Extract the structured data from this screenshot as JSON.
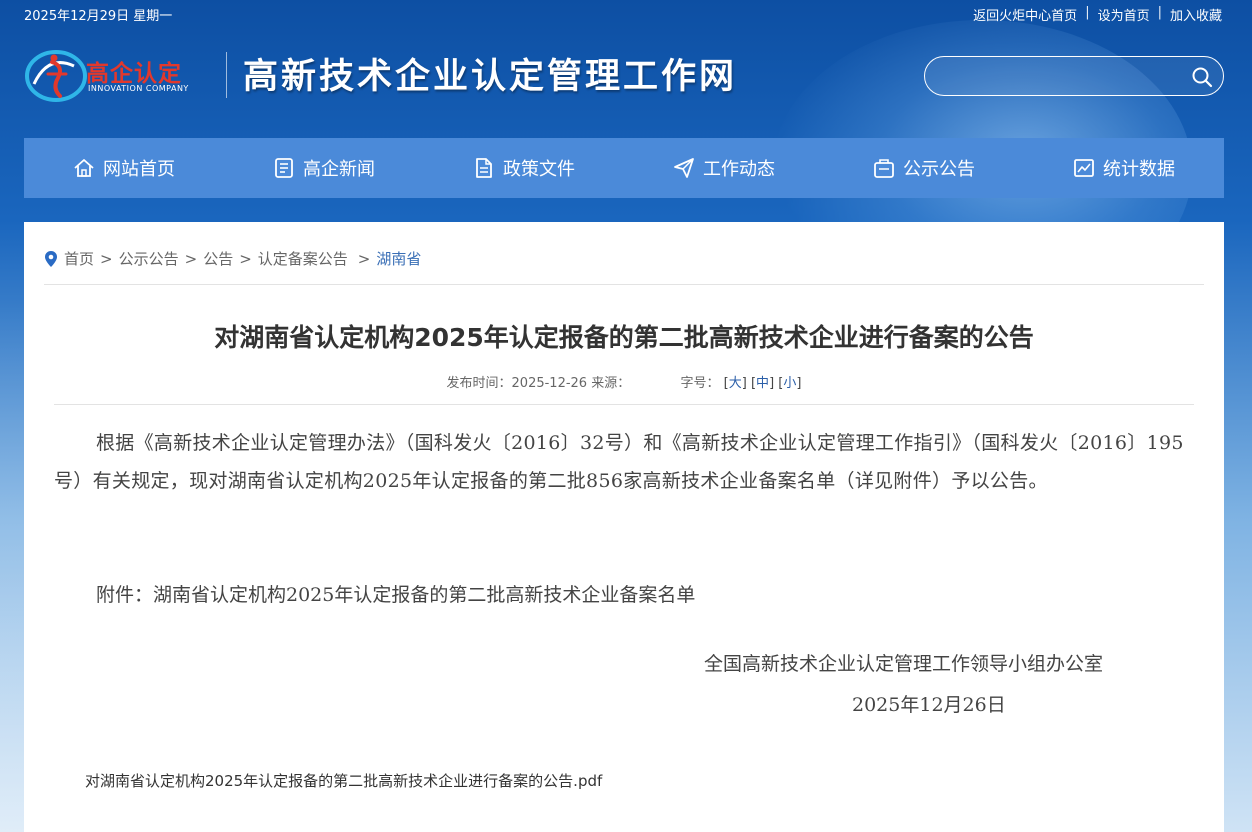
{
  "topbar": {
    "date": "2025年12月29日 星期一",
    "links": [
      "返回火炬中心首页",
      "设为首页",
      "加入收藏"
    ]
  },
  "logo": {
    "cn": "高企认定",
    "en": "INNOVATION COMPANY"
  },
  "site_title": "高新技术企业认定管理工作网",
  "search": {
    "placeholder": "",
    "icon": "search-icon"
  },
  "nav": [
    {
      "label": "网站首页",
      "icon": "home-icon"
    },
    {
      "label": "高企新闻",
      "icon": "news-icon"
    },
    {
      "label": "政策文件",
      "icon": "document-icon"
    },
    {
      "label": "工作动态",
      "icon": "paper-plane-icon"
    },
    {
      "label": "公示公告",
      "icon": "announcement-icon"
    },
    {
      "label": "统计数据",
      "icon": "chart-icon"
    }
  ],
  "breadcrumb": {
    "items": [
      "首页",
      "公示公告",
      "公告",
      "认定备案公告"
    ],
    "separator": ">",
    "current": "湖南省"
  },
  "article": {
    "title": "对湖南省认定机构2025年认定报备的第二批高新技术企业进行备案的公告",
    "meta_time": "发布时间：2025-12-26 来源：",
    "font_size_label": "字号：",
    "font_sizes": [
      "大",
      "中",
      "小"
    ],
    "paragraph1": "根据《高新技术企业认定管理办法》（国科发火〔2016〕32号）和《高新技术企业认定管理工作指引》（国科发火〔2016〕195号）有关规定，现对湖南省认定机构2025年认定报备的第二批856家高新技术企业备案名单（详见附件）予以公告。",
    "paragraph2": "附件：湖南省认定机构2025年认定报备的第二批高新技术企业备案名单",
    "signature_org": "全国高新技术企业认定管理工作领导小组办公室",
    "signature_date": "2025年12月26日",
    "attachment": "对湖南省认定机构2025年认定报备的第二批高新技术企业进行备案的公告.pdf"
  },
  "colors": {
    "nav_bg": "#4b8ad9",
    "logo_red": "#e2382c",
    "breadcrumb_current": "#3a6fb6"
  }
}
